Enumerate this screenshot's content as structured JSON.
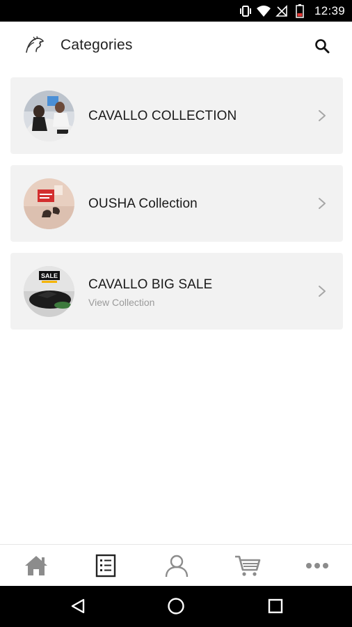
{
  "status_bar": {
    "time": "12:39",
    "icons": [
      "vibrate-icon",
      "wifi-icon",
      "no-signal-icon",
      "battery-low-icon"
    ]
  },
  "header": {
    "title": "Categories",
    "logo": "horse-logo",
    "search_icon": "search-icon"
  },
  "categories": [
    {
      "title": "CAVALLO COLLECTION",
      "subtitle": "",
      "chevron_icon": "chevron-right-icon"
    },
    {
      "title": "OUSHA Collection",
      "subtitle": "",
      "chevron_icon": "chevron-right-icon"
    },
    {
      "title": "CAVALLO BIG SALE",
      "subtitle": "View Collection",
      "badge": "SALE",
      "chevron_icon": "chevron-right-icon"
    }
  ],
  "bottom_nav": {
    "items": [
      "home-icon",
      "categories-list-icon",
      "account-icon",
      "cart-icon",
      "more-icon"
    ],
    "active_index": 1
  },
  "android_nav": {
    "buttons": [
      "back-icon",
      "home-circle-icon",
      "recents-icon"
    ]
  },
  "colors": {
    "card_background": "#f2f2f2",
    "title_text": "#1a1a1a",
    "subtitle_text": "#9a9a9a",
    "nav_icon_inactive": "#8c8c8c",
    "nav_icon_active": "#222222",
    "status_bar": "#000000"
  }
}
